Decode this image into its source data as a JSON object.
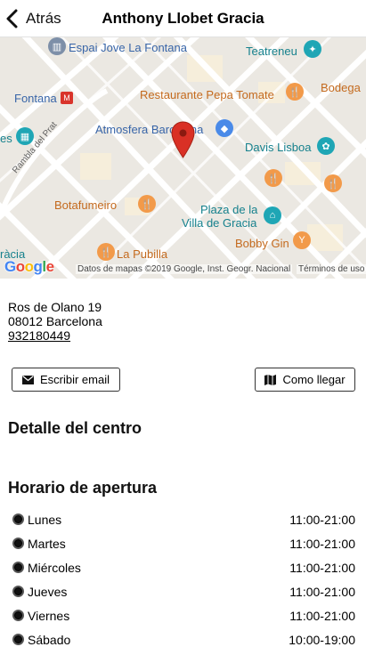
{
  "header": {
    "back_label": "Atrás",
    "title": "Anthony Llobet Gracia"
  },
  "map": {
    "labels": {
      "espai": "Espai Jove La Fontana",
      "teatreneu": "Teatreneu",
      "fontana": "Fontana",
      "restaurante": "Restaurante Pepa Tomate",
      "bodega": "Bodega",
      "atmosfera": "Atmosfera Barcelona",
      "davis": "Davis Lisboa",
      "rambla": "Rambla del Prat",
      "botafumeiro": "Botafumeiro",
      "plaza1": "Plaza de la",
      "plaza2": "Villa de Gracia",
      "bobby": "Bobby Gin",
      "pubilla": "La Pubilla",
      "es": "es",
      "gracia": "ràcia"
    },
    "google_logo": "Google",
    "attribution": "Datos de mapas ©2019 Google, Inst. Geogr. Nacional",
    "terms": "Términos de uso"
  },
  "address": {
    "street": "Ros de Olano 19",
    "city": "08012 Barcelona",
    "phone": "932180449"
  },
  "buttons": {
    "email": "Escribir email",
    "directions": "Como llegar"
  },
  "sections": {
    "detail": "Detalle del centro",
    "hours": "Horario de apertura"
  },
  "hours": [
    {
      "day": "Lunes",
      "time": "11:00-21:00"
    },
    {
      "day": "Martes",
      "time": "11:00-21:00"
    },
    {
      "day": "Miércoles",
      "time": "11:00-21:00"
    },
    {
      "day": "Jueves",
      "time": "11:00-21:00"
    },
    {
      "day": "Viernes",
      "time": "11:00-21:00"
    },
    {
      "day": "Sábado",
      "time": "10:00-19:00"
    }
  ],
  "colors": {
    "pin": "#d93025",
    "poi_orange": "#f29a4a",
    "poi_teal": "#1fa6b5",
    "poi_blue": "#4a8ae8",
    "map_text_orange": "#c46a1e",
    "map_text_blue": "#3865a8",
    "map_text_teal": "#16818d"
  }
}
